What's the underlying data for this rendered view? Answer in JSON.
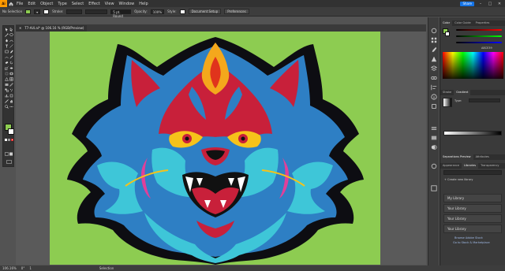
{
  "menubar": {
    "logo": "Ai",
    "items": [
      "File",
      "Edit",
      "Object",
      "Type",
      "Select",
      "Effect",
      "View",
      "Window",
      "Help"
    ],
    "share": "Share"
  },
  "control": {
    "selection": "No Selection",
    "stroke_label": "Stroke:",
    "brush": "5 pt. Round",
    "opacity_label": "Opacity:",
    "opacity_value": "100%",
    "style_label": "Style:",
    "document_setup": "Document Setup",
    "preferences": "Preferences"
  },
  "document": {
    "tab_title": "T7-Ai4.ai* @ 106.16 % (RGB/Preview)"
  },
  "status": {
    "zoom": "106.16%",
    "angle": "0°",
    "page": "1",
    "tool": "Selection"
  },
  "panels": {
    "top_tabs": [
      "Color",
      "Color Guide",
      "Properties"
    ],
    "hex_value": "A8CE39",
    "stroke_tabs": [
      "Stroke",
      "Gradient"
    ],
    "type_label": "Type:",
    "separations_tabs": [
      "Separations Preview",
      "Attributes"
    ],
    "library_tabs": [
      "Appearance",
      "Libraries",
      "Transparency"
    ],
    "create_library": "+ Create new library",
    "libraries": [
      "My Library",
      "Your Library",
      "Your Library",
      "Your Library"
    ],
    "footer_line1": "Browse Adobe Stock",
    "footer_line2": "Go to Stock & Marketplace"
  },
  "colors": {
    "artboard": "#8dcc51",
    "accent": "#1473e6",
    "fill_swatch": "#8dcc51"
  }
}
